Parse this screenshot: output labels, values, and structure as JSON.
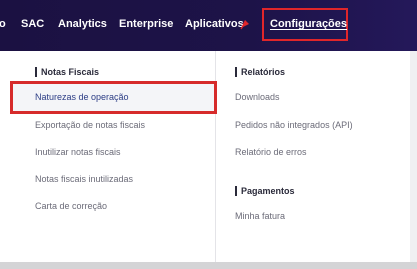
{
  "topnav": {
    "items": [
      {
        "label": "o"
      },
      {
        "label": "SAC"
      },
      {
        "label": "Analytics"
      },
      {
        "label": "Enterprise"
      },
      {
        "label": "Aplicativos"
      },
      {
        "label": "Configurações"
      }
    ],
    "active": "Configurações",
    "accent_color": "#e0262a"
  },
  "dropdown": {
    "left": {
      "title": "Notas Fiscais",
      "items": [
        {
          "label": "Naturezas de operação"
        },
        {
          "label": "Exportação de notas fiscais"
        },
        {
          "label": "Inutilizar notas fiscais"
        },
        {
          "label": "Notas fiscais inutilizadas"
        },
        {
          "label": "Carta de correção"
        }
      ]
    },
    "right": {
      "relatorios_title": "Relatórios",
      "relatorios_items": [
        {
          "label": "Downloads"
        },
        {
          "label": "Pedidos não integrados (API)"
        },
        {
          "label": "Relatório de erros"
        }
      ],
      "pagamentos_title": "Pagamentos",
      "pagamentos_items": [
        {
          "label": "Minha fatura"
        }
      ]
    }
  }
}
